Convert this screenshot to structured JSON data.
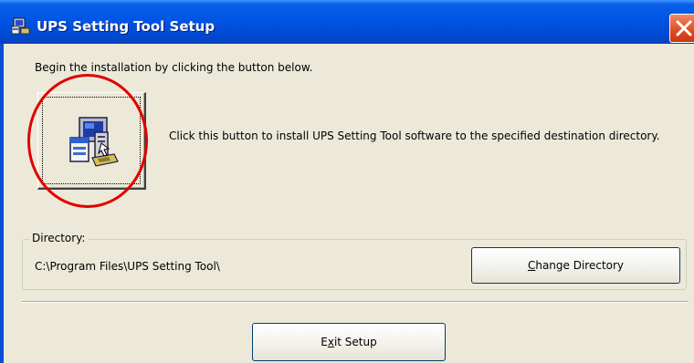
{
  "window": {
    "title": "UPS Setting Tool Setup",
    "title_icon": "setup-app-icon",
    "close_icon": "close-icon"
  },
  "intro": {
    "text": "Begin the installation by clicking the button below."
  },
  "install": {
    "icon": "installer-computer-icon",
    "description": "Click this button to install UPS Setting Tool software to the specified destination directory."
  },
  "directory": {
    "label": "Directory:",
    "path": "C:\\Program Files\\UPS Setting Tool\\",
    "change_button": {
      "accelerator": "C",
      "label_rest": "hange Directory"
    }
  },
  "exit_button": {
    "label_pre": "E",
    "accelerator": "x",
    "label_post": "it Setup"
  },
  "colors": {
    "titlebar": "#0055e5",
    "dialog_bg": "#ece9d8",
    "close_button": "#e04a20",
    "annotation_circle": "#e00000"
  }
}
